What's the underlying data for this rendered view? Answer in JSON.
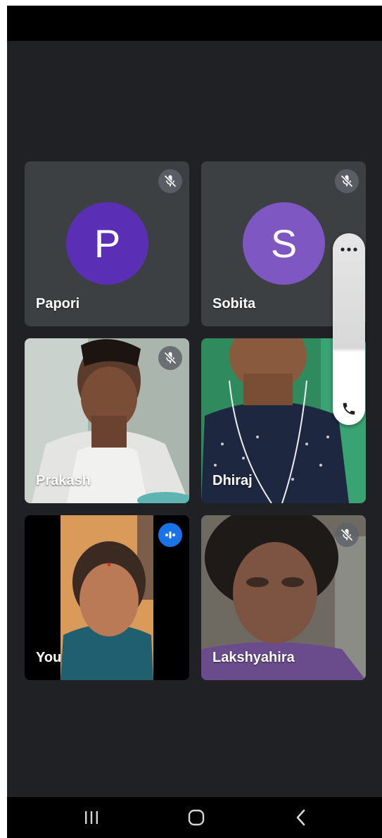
{
  "participants": [
    {
      "name": "Papori",
      "initial": "P",
      "avatar_color": "#5b2fb5",
      "muted": true
    },
    {
      "name": "Sobita",
      "initial": "S",
      "avatar_color": "#7e57c2",
      "muted": true
    },
    {
      "name": "Prakash",
      "muted": true
    },
    {
      "name": "Dhiraj",
      "muted": false
    },
    {
      "name": "You",
      "speaking": true
    },
    {
      "name": "Lakshyahira",
      "muted": true
    }
  ],
  "icons": {
    "mute": "mic-off-icon",
    "speaking": "speaking-indicator-icon",
    "more": "more-options-icon",
    "call": "phone-icon",
    "nav_recent": "recent-apps-icon",
    "nav_home": "home-icon",
    "nav_back": "back-icon"
  },
  "colors": {
    "background": "#202124",
    "tile": "#3c4043",
    "speaking_badge": "#1a73e8"
  }
}
